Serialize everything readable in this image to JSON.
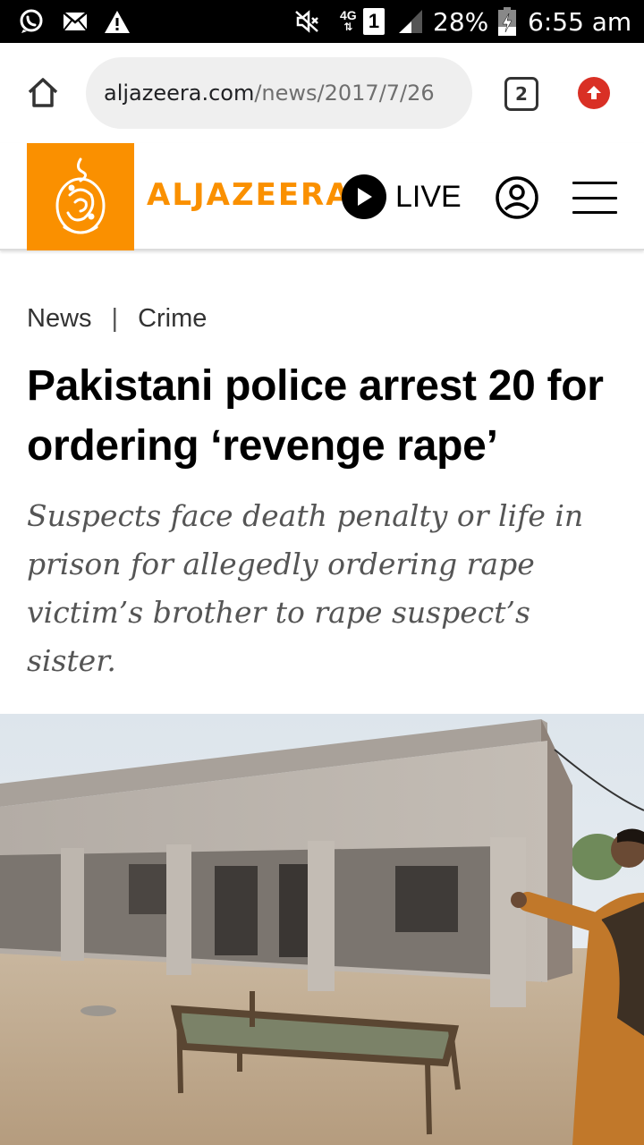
{
  "status_bar": {
    "time": "6:55 am",
    "battery_percent": "28%",
    "network_label": "4G",
    "sim_slot": "1",
    "icons": [
      "whatsapp-icon",
      "mail-icon",
      "warning-icon",
      "mute-icon",
      "signal-icon",
      "battery-charging-icon"
    ]
  },
  "browser": {
    "url_host": "aljazeera.com",
    "url_path": "/news/2017/7/26",
    "tab_count": "2",
    "icons": [
      "home-icon",
      "tabs-icon",
      "update-icon"
    ],
    "update_color": "#d93025"
  },
  "site_header": {
    "brand": "ALJAZEERA",
    "live_label": "LIVE",
    "brand_color": "#fa9000",
    "icons": [
      "aljazeera-logo",
      "play-icon",
      "account-icon",
      "menu-icon"
    ]
  },
  "article": {
    "breadcrumb": [
      "News",
      "Crime"
    ],
    "breadcrumb_separator": "|",
    "headline": "Pakistani police arrest 20 for ordering ‘revenge rape’",
    "subheadline": "Suspects face death penalty or life in prison for allegedly ordering rape victim’s brother to rape suspect’s sister."
  },
  "photo": {
    "content": "Single-storey concrete building with arched veranda, a woven charpoy bed on dry ground, and a boy pointing at the house"
  }
}
